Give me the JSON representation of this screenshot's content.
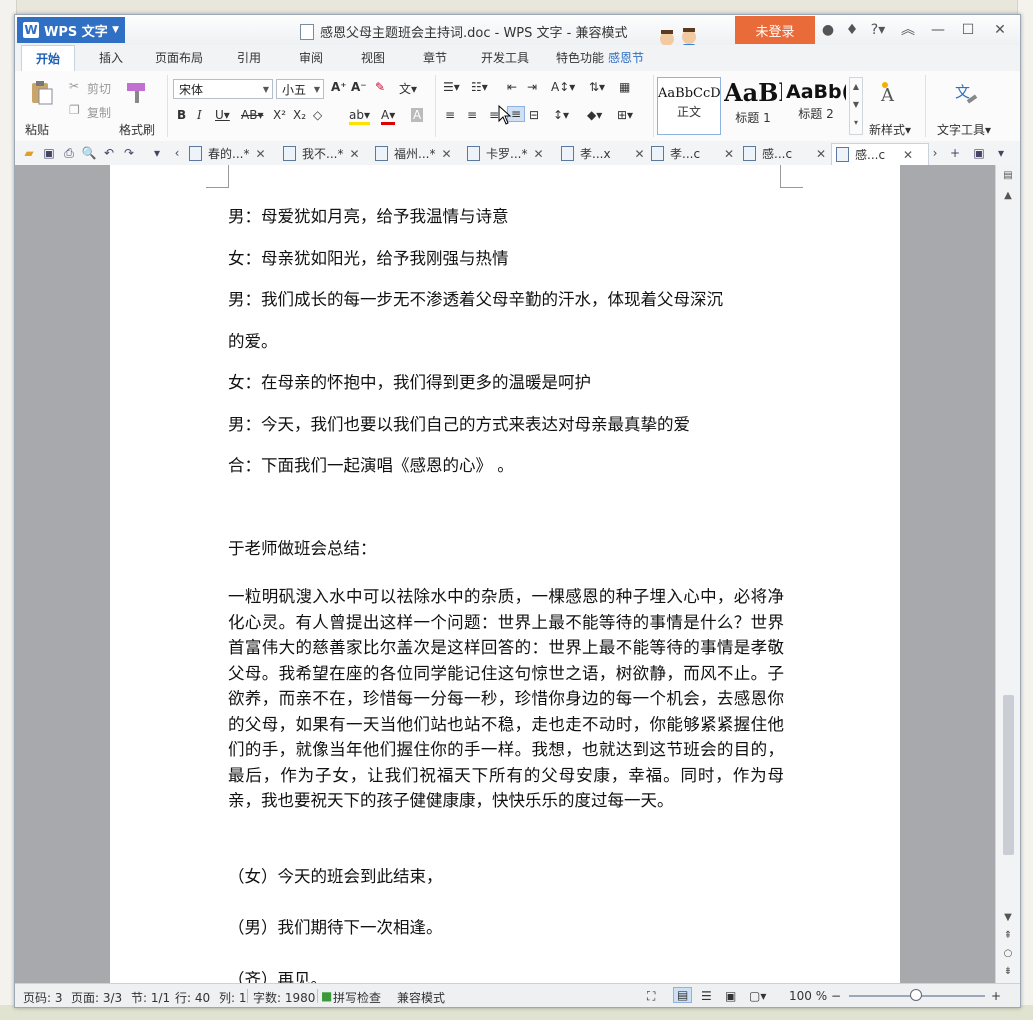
{
  "titlebar": {
    "app_name": "WPS 文字",
    "doc_title": "感恩父母主题班会主持词.doc - WPS 文字 - 兼容模式",
    "login": "未登录"
  },
  "menu_tabs": [
    "开始",
    "插入",
    "页面布局",
    "引用",
    "审阅",
    "视图",
    "章节",
    "开发工具",
    "特色功能",
    "感恩节"
  ],
  "ribbon": {
    "paste": "粘贴",
    "cut": "剪切",
    "copy": "复制",
    "format_painter": "格式刷",
    "font_name": "宋体",
    "font_size": "小五",
    "styles": [
      {
        "preview": "AaBbCcD",
        "name": "正文"
      },
      {
        "preview": "AaBl",
        "name": "标题 1"
      },
      {
        "preview": "AaBb(",
        "name": "标题 2"
      }
    ],
    "new_style": "新样式",
    "text_tools": "文字工具"
  },
  "doc_tabs": [
    "春的...*",
    "我不...*",
    "福州...*",
    "卡罗...*",
    "孝...x",
    "孝...c",
    "感...c",
    "感...c"
  ],
  "document": {
    "lines": [
      "男：母爱犹如月亮，给予我温情与诗意",
      "女：母亲犹如阳光，给予我刚强与热情",
      "男：我们成长的每一步无不渗透着父母辛勤的汗水，体现着父母深沉",
      "的爱。",
      "女：在母亲的怀抱中，我们得到更多的温暖是呵护",
      "男：今天，我们也要以我们自己的方式来表达对母亲最真挚的爱",
      "合：下面我们一起演唱《感恩的心》 。",
      "于老师做班会总结："
    ],
    "summary": "一粒明矾溲入水中可以祛除水中的杂质，一棵感恩的种子埋入心中，必将净化心灵。有人曾提出这样一个问题：世界上最不能等待的事情是什么？世界首富伟大的慈善家比尔盖次是这样回答的：世界上最不能等待的事情是孝敬父母。我希望在座的各位同学能记住这句惊世之语，树欲静，而风不止。子欲养，而亲不在，珍惜每一分每一秒，珍惜你身边的每一个机会，去感恩你的父母，如果有一天当他们站也站不稳，走也走不动时，你能够紧紧握住他们的手，就像当年他们握住你的手一样。我想，也就达到这节班会的目的，最后，作为子女，让我们祝福天下所有的父母安康，幸福。同时，作为母亲，我也要祝天下的孩子健健康康，快快乐乐的度过每一天。",
    "closing": [
      "（女）今天的班会到此结束，",
      "（男）我们期待下一次相逢。",
      "（齐）再见。"
    ]
  },
  "status": {
    "page_code": "页码: 3",
    "pages": "页面: 3/3",
    "section": "节: 1/1",
    "row": "行: 40",
    "col": "列: 1",
    "word_count": "字数: 1980",
    "spell_check": "拼写检查",
    "compat_mode": "兼容模式",
    "zoom": "100 %"
  },
  "colors": {
    "app_blue": "#2f6fc4",
    "login_orange": "#ea6b3a",
    "active_tab_text": "#1f5fb4"
  }
}
